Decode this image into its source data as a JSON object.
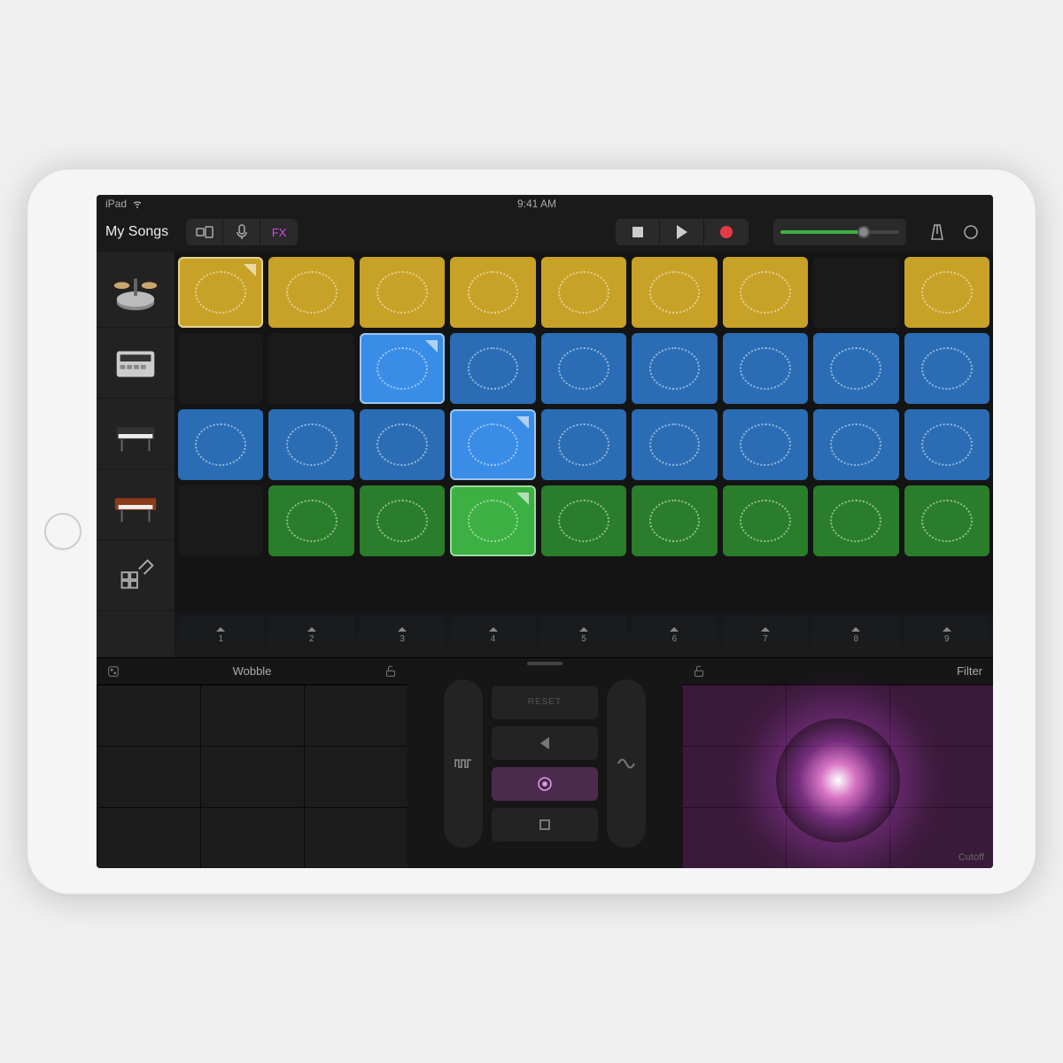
{
  "status": {
    "device": "iPad",
    "time": "9:41 AM"
  },
  "toolbar": {
    "back_label": "My Songs",
    "fx_label": "FX"
  },
  "tracks": [
    {
      "name": "drums"
    },
    {
      "name": "sampler"
    },
    {
      "name": "keyboard"
    },
    {
      "name": "synth"
    },
    {
      "name": "fx-grid"
    }
  ],
  "grid": {
    "rows": [
      {
        "color": "yellow",
        "cells": [
          "active",
          "filled",
          "filled",
          "filled",
          "filled",
          "filled",
          "filled",
          "empty",
          "filled"
        ]
      },
      {
        "color": "blue",
        "cells": [
          "empty",
          "empty",
          "active-bright",
          "filled",
          "filled",
          "filled",
          "filled",
          "filled",
          "filled"
        ]
      },
      {
        "color": "blue",
        "cells": [
          "filled",
          "filled",
          "filled",
          "active-bright",
          "filled",
          "filled",
          "filled",
          "filled",
          "filled"
        ]
      },
      {
        "color": "green",
        "cells": [
          "empty",
          "filled",
          "filled",
          "active-bright",
          "filled",
          "filled",
          "filled",
          "filled",
          "filled"
        ]
      }
    ]
  },
  "triggers": [
    "1",
    "2",
    "3",
    "4",
    "5",
    "6",
    "7",
    "8",
    "9"
  ],
  "fx": {
    "left_label": "Wobble",
    "right_label": "Filter",
    "right_axis": "Cutoff",
    "reset_label": "RESET"
  }
}
